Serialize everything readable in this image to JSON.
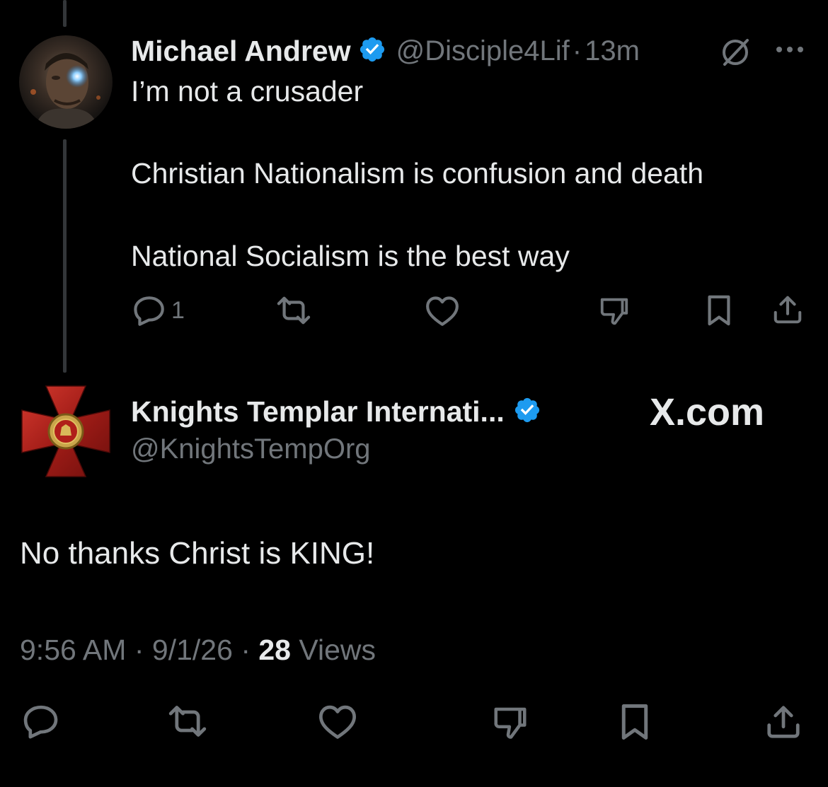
{
  "parent_tweet": {
    "author_name": "Michael Andrew",
    "handle": "@Disciple4Lif",
    "separator": "·",
    "time": "13m",
    "lines": [
      "I’m not a crusader",
      "Christian Nationalism is confusion and death",
      "National Socialism is the best way"
    ],
    "reply_count": "1"
  },
  "main_tweet": {
    "author_name": "Knights Templar Internati...",
    "handle": "@KnightsTempOrg",
    "text": "No thanks Christ is KING!",
    "time": "9:56 AM",
    "date": "9/1/26",
    "separator": "·",
    "views_count": "28",
    "views_label": "Views"
  },
  "watermark": "X.com",
  "colors": {
    "verified": "#1d9bf0",
    "muted": "#71767b",
    "text": "#e7e9ea",
    "background": "#000000"
  },
  "icons": [
    "verified-badge-icon",
    "grok-icon",
    "more-icon",
    "reply-icon",
    "retweet-icon",
    "like-icon",
    "dislike-icon",
    "bookmark-icon",
    "share-icon"
  ]
}
